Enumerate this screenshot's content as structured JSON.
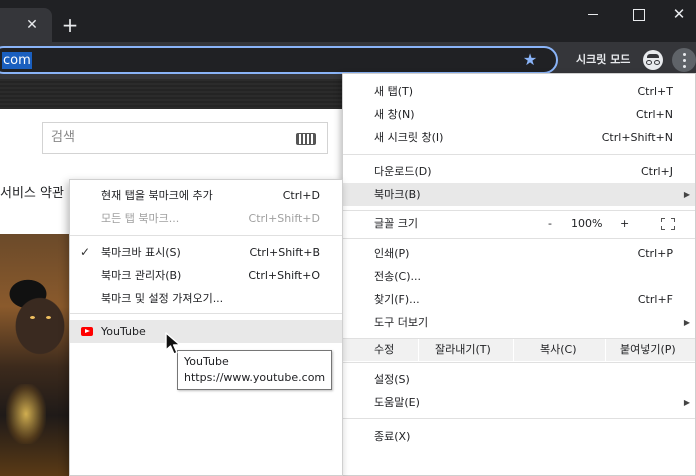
{
  "window": {
    "tab_close_glyph": "✕",
    "new_tab_glyph": "+",
    "close_glyph": "✕"
  },
  "toolbar": {
    "url_visible": "com",
    "incognito_label": "시크릿 모드",
    "accent_color": "#8ab4f8"
  },
  "page": {
    "search_placeholder": "검색",
    "service_text": "서비스 약관"
  },
  "main_menu": {
    "items": [
      {
        "label": "새 탭(T)",
        "shortcut": "Ctrl+T"
      },
      {
        "label": "새 창(N)",
        "shortcut": "Ctrl+N"
      },
      {
        "label": "새 시크릿 창(I)",
        "shortcut": "Ctrl+Shift+N"
      },
      {
        "label": "다운로드(D)",
        "shortcut": "Ctrl+J"
      },
      {
        "label": "북마크(B)",
        "shortcut": ""
      },
      {
        "label": "글꼴 크기",
        "shortcut": ""
      },
      {
        "label": "인쇄(P)",
        "shortcut": "Ctrl+P"
      },
      {
        "label": "전송(C)...",
        "shortcut": ""
      },
      {
        "label": "찾기(F)...",
        "shortcut": "Ctrl+F"
      },
      {
        "label": "도구 더보기",
        "shortcut": ""
      },
      {
        "label": "설정(S)",
        "shortcut": ""
      },
      {
        "label": "도움말(E)",
        "shortcut": ""
      },
      {
        "label": "종료(X)",
        "shortcut": ""
      }
    ],
    "zoom": {
      "minus": "-",
      "value": "100%",
      "plus": "+"
    },
    "edit": {
      "label": "수정",
      "cut": "잘라내기(T)",
      "copy": "복사(C)",
      "paste": "붙여넣기(P)"
    }
  },
  "bookmark_menu": {
    "items": [
      {
        "label": "현재 탭을 북마크에 추가",
        "shortcut": "Ctrl+D"
      },
      {
        "label": "모든 탭 북마크...",
        "shortcut": "Ctrl+Shift+D"
      },
      {
        "label": "북마크바 표시(S)",
        "shortcut": "Ctrl+Shift+B"
      },
      {
        "label": "북마크 관리자(B)",
        "shortcut": "Ctrl+Shift+O"
      },
      {
        "label": "북마크 및 설정 가져오기...",
        "shortcut": ""
      },
      {
        "label": "YouTube",
        "shortcut": ""
      }
    ],
    "check_glyph": "✓"
  },
  "tooltip": {
    "title": "YouTube",
    "url": "https://www.youtube.com"
  }
}
